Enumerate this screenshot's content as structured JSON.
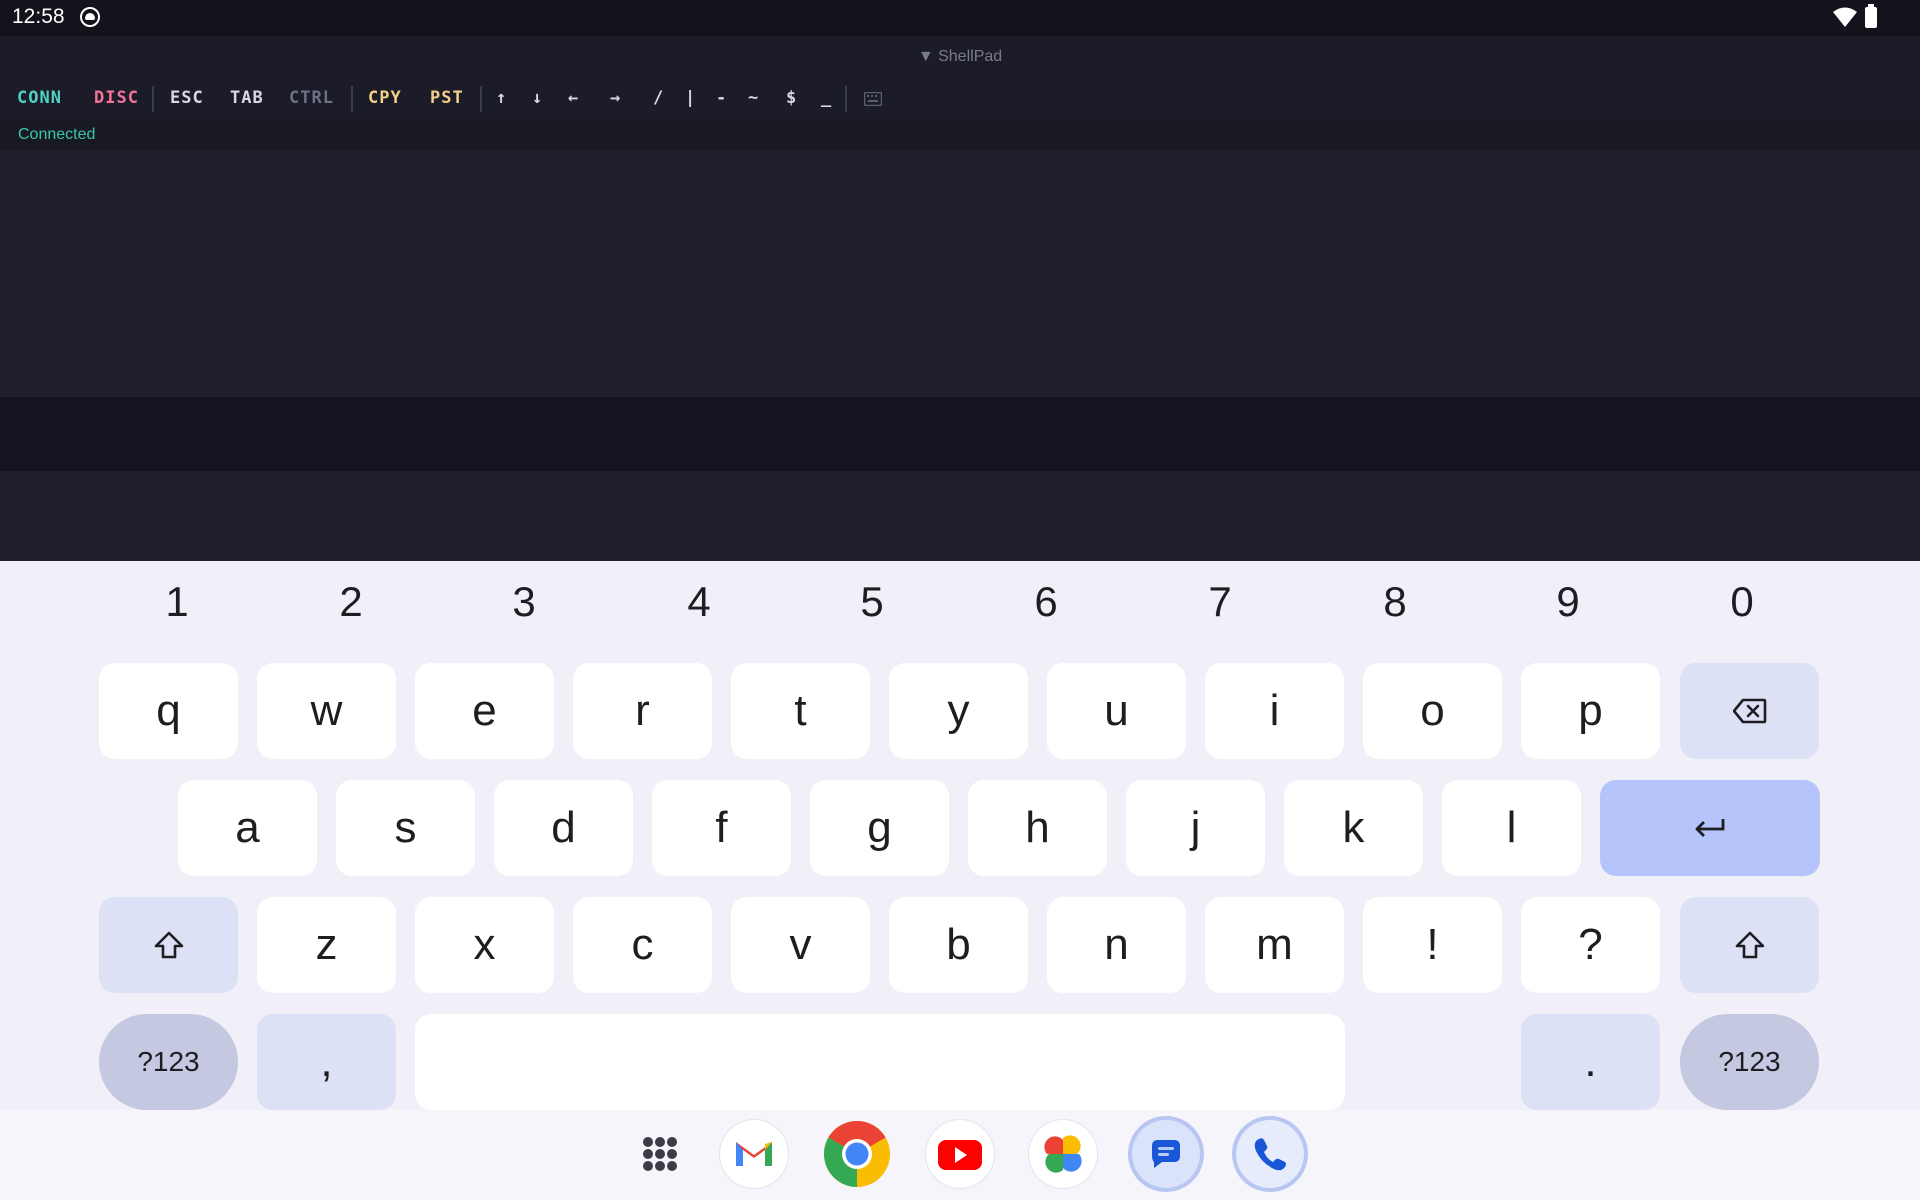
{
  "status_bar": {
    "time": "12:58",
    "icons": [
      "notification-icon",
      "wifi-icon",
      "battery-icon"
    ]
  },
  "app": {
    "title": "▼ ShellPad",
    "toolbar": {
      "conn": "CONN",
      "disc": "DISC",
      "esc": "ESC",
      "tab": "TAB",
      "ctrl": "CTRL",
      "cpy": "CPY",
      "pst": "PST",
      "up": "↑",
      "down": "↓",
      "left": "←",
      "right": "→",
      "slash": "/",
      "pipe": "|",
      "dash": "-",
      "tilde": "~",
      "dollar": "$",
      "underscore": "_",
      "keyboard_icon": "keyboard-icon"
    },
    "status": "Connected",
    "colors": {
      "conn": "#4fd1c5",
      "disc": "#f47399",
      "neutral": "#d8d8e4",
      "ctrl": "#6e7089",
      "clip": "#f3d08a",
      "status": "#36c7a6"
    }
  },
  "keyboard": {
    "numbers": [
      "1",
      "2",
      "3",
      "4",
      "5",
      "6",
      "7",
      "8",
      "9",
      "0"
    ],
    "row1": [
      "q",
      "w",
      "e",
      "r",
      "t",
      "y",
      "u",
      "i",
      "o",
      "p"
    ],
    "row2": [
      "a",
      "s",
      "d",
      "f",
      "g",
      "h",
      "j",
      "k",
      "l"
    ],
    "row3": [
      "z",
      "x",
      "c",
      "v",
      "b",
      "n",
      "m",
      "!",
      "?"
    ],
    "symbols_left": "?123",
    "comma": ",",
    "period": ".",
    "symbols_right": "?123",
    "backspace_icon": "backspace-icon",
    "enter_icon": "enter-icon",
    "shift_icon": "shift-icon"
  },
  "dock": {
    "apps": [
      "app-drawer-icon",
      "gmail-icon",
      "chrome-icon",
      "youtube-icon",
      "photos-icon",
      "messages-icon",
      "phone-icon"
    ]
  }
}
